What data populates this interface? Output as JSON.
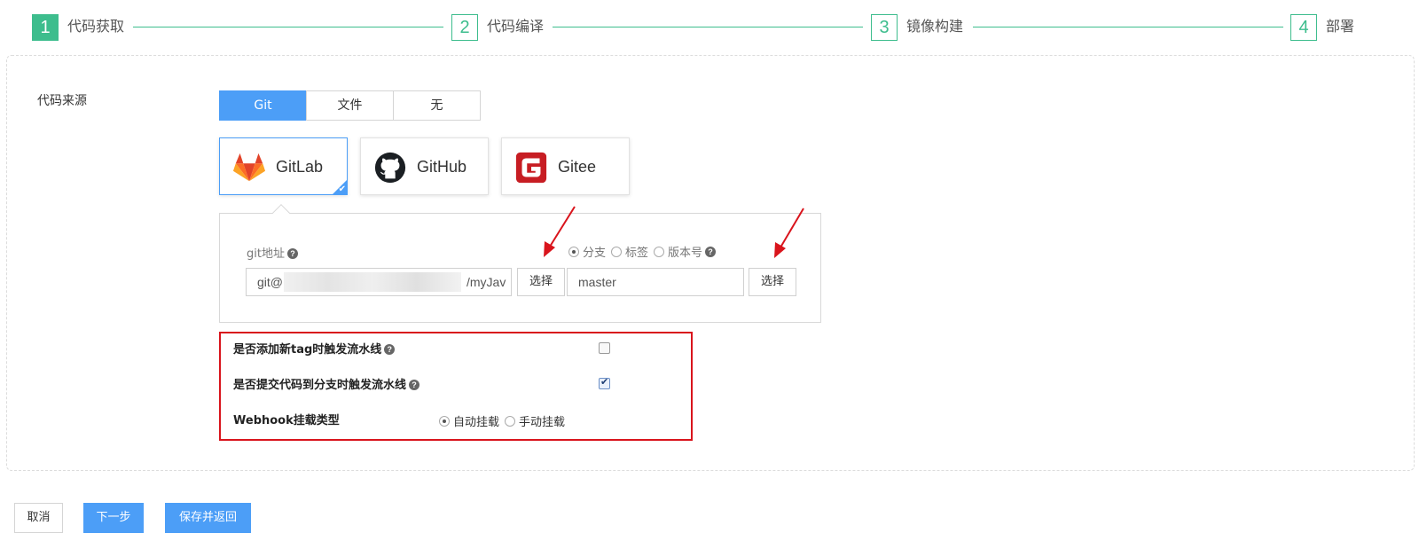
{
  "steps": [
    {
      "num": "1",
      "label": "代码获取"
    },
    {
      "num": "2",
      "label": "代码编译"
    },
    {
      "num": "3",
      "label": "镜像构建"
    },
    {
      "num": "4",
      "label": "部署"
    }
  ],
  "source": {
    "label": "代码来源",
    "tabs": [
      "Git",
      "文件",
      "无"
    ],
    "selected_tab": "Git"
  },
  "providers": [
    {
      "name": "GitLab",
      "icon": "gitlab-icon"
    },
    {
      "name": "GitHub",
      "icon": "github-icon"
    },
    {
      "name": "Gitee",
      "icon": "gitee-icon"
    }
  ],
  "selected_provider": "GitLab",
  "git": {
    "address_label": "git地址",
    "address_value_prefix": "git@",
    "address_value_tail": "/myJav",
    "choose_label": "选择",
    "ref_types": [
      "分支",
      "标签",
      "版本号"
    ],
    "selected_ref_type": "分支",
    "branch_value": "master",
    "choose_label_2": "选择"
  },
  "options": {
    "tag_trigger_label": "是否添加新tag时触发流水线",
    "tag_trigger_checked": false,
    "commit_trigger_label": "是否提交代码到分支时触发流水线",
    "commit_trigger_checked": true,
    "webhook_label": "Webhook挂载类型",
    "webhook_types": [
      "自动挂载",
      "手动挂载"
    ],
    "webhook_selected": "自动挂载"
  },
  "buttons": {
    "cancel": "取消",
    "next": "下一步",
    "save": "保存并返回"
  },
  "colors": {
    "step_accent": "#3dbd8d",
    "primary": "#4c9ef7",
    "highlight_red": "#d9141c"
  }
}
